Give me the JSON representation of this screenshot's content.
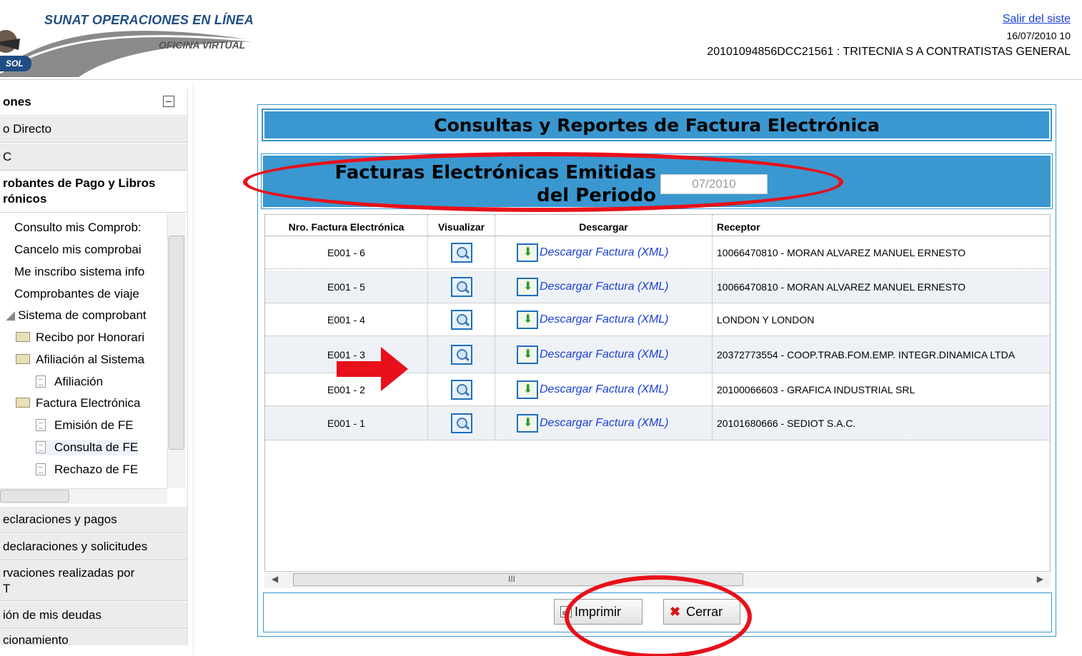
{
  "header": {
    "brand_line1": "SUNAT OPERACIONES EN LÍNEA",
    "brand_line2": "OFICINA VIRTUAL",
    "sol_badge": "SOL",
    "logout": "Salir del siste",
    "date": "16/07/2010 10",
    "user": "20101094856DCC21561 : TRITECNIA S A CONTRATISTAS GENERAL"
  },
  "sidebar": {
    "title": "ones",
    "sections_top": [
      "o Directo",
      "C"
    ],
    "section_active_line1": "robantes de Pago y Libros",
    "section_active_line2": "rónicos",
    "tree": [
      "Consulto mis Comprob:",
      "Cancelo mis comprobai",
      "Me inscribo sistema info",
      "Comprobantes de viaje",
      "Sistema de comprobant",
      "Recibo por Honorari",
      "Afiliación al Sistema",
      "Afiliación",
      "Factura Electrónica",
      "Emisión de FE",
      "Consulta de FE",
      "Rechazo de FE"
    ],
    "sections_bottom": [
      "eclaraciones y pagos",
      "declaraciones y solicitudes",
      "rvaciones realizadas por",
      "T",
      "ión de mis deudas",
      "cionamiento"
    ]
  },
  "main": {
    "title": "Consultas y Reportes de Factura Electrónica",
    "period_label_line1": "Facturas Electrónicas Emitidas",
    "period_label_line2": "del Periodo",
    "period_value": "07/2010",
    "columns": [
      "Nro. Factura Electrónica",
      "Visualizar",
      "Descargar",
      "Receptor"
    ],
    "rows": [
      {
        "nro": "E001 - 6",
        "download": "Descargar Factura (XML)",
        "receptor": "10066470810 - MORAN ALVAREZ MANUEL ERNESTO"
      },
      {
        "nro": "E001 - 5",
        "download": "Descargar Factura (XML)",
        "receptor": "10066470810 - MORAN ALVAREZ MANUEL ERNESTO"
      },
      {
        "nro": "E001 - 4",
        "download": "Descargar Factura (XML)",
        "receptor": "LONDON Y LONDON"
      },
      {
        "nro": "E001 - 3",
        "download": "Descargar Factura (XML)",
        "receptor": "20372773554 - COOP.TRAB.FOM.EMP. INTEGR.DINAMICA LTDA"
      },
      {
        "nro": "E001 - 2",
        "download": "Descargar Factura (XML)",
        "receptor": "20100066603 - GRAFICA INDUSTRIAL SRL"
      },
      {
        "nro": "E001 - 1",
        "download": "Descargar Factura (XML)",
        "receptor": "20101680666 - SEDIOT S.A.C."
      }
    ],
    "scroll_label": "III",
    "print_button": "Imprimir",
    "close_button": "Cerrar"
  },
  "colors": {
    "accent": "#3a97d0",
    "annotation": "#e8101a",
    "link": "#1a3fd6"
  }
}
